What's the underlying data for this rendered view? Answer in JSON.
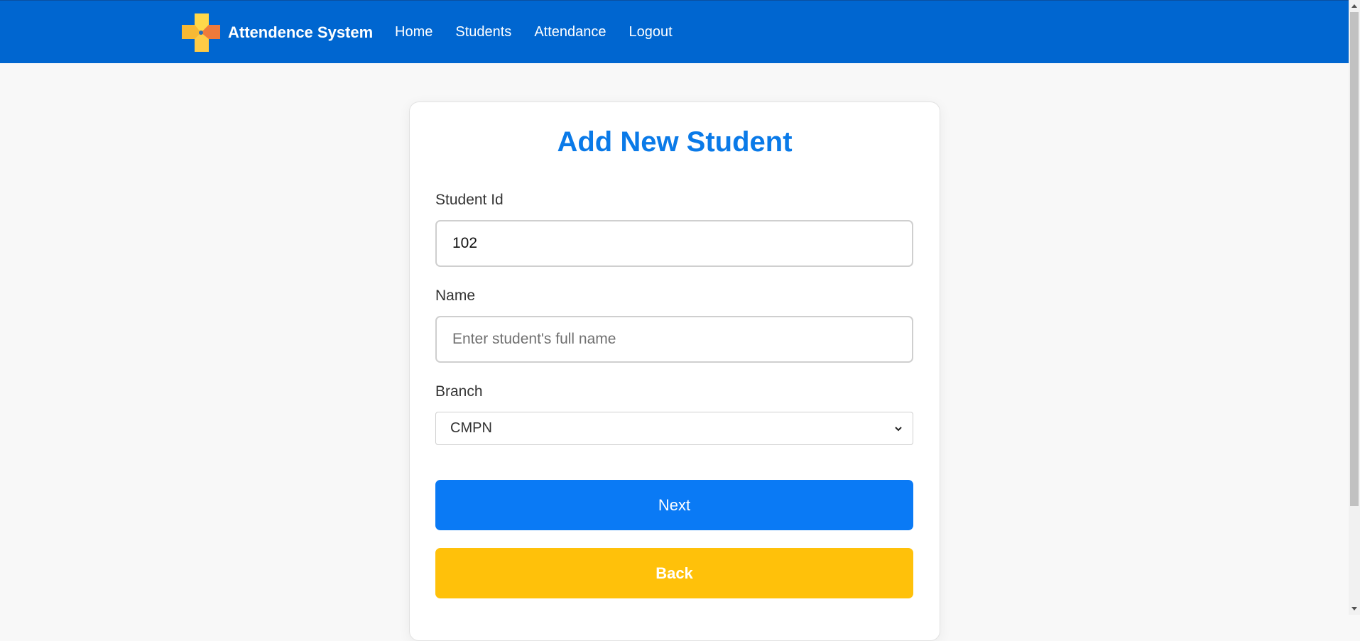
{
  "navbar": {
    "brand": "Attendence System",
    "links": [
      "Home",
      "Students",
      "Attendance",
      "Logout"
    ],
    "bg_color": "#0066d0"
  },
  "form": {
    "title": "Add New Student",
    "student_id": {
      "label": "Student Id",
      "value": "102"
    },
    "name": {
      "label": "Name",
      "placeholder": "Enter student's full name",
      "value": ""
    },
    "branch": {
      "label": "Branch",
      "selected": "CMPN"
    },
    "next_label": "Next",
    "back_label": "Back"
  },
  "colors": {
    "title": "#0a7ae8",
    "next_button": "#0a7af5",
    "back_button": "#ffc10a"
  },
  "icons": {
    "logo": "brand-logo-icon",
    "select": "chevron-down-icon"
  }
}
